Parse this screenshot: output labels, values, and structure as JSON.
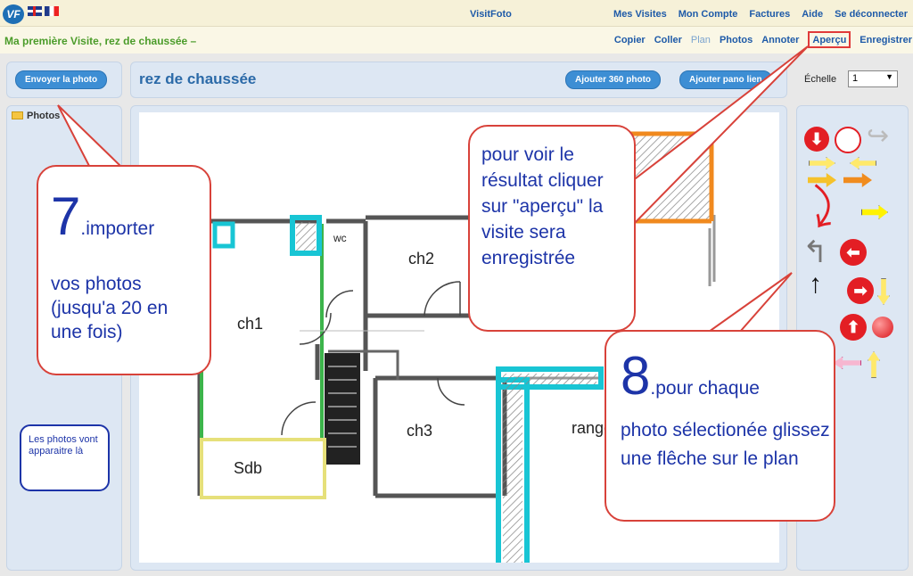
{
  "topbar": {
    "logo": "VF",
    "brand": "VisitFoto",
    "nav": [
      "Mes Visites",
      "Mon Compte",
      "Factures",
      "Aide",
      "Se déconnecter"
    ]
  },
  "subbar": {
    "title": "Ma première Visite, rez de chaussée –",
    "actions": {
      "copier": "Copier",
      "coller": "Coller",
      "plan": "Plan",
      "photos": "Photos",
      "annoter": "Annoter",
      "apercu": "Aperçu",
      "enregistrer": "Enregistrer"
    }
  },
  "left": {
    "send_button": "Envoyer la photo",
    "tree_label": "Photos",
    "note": "Les photos vont apparaitre là"
  },
  "header": {
    "title": "rez de chaussée",
    "add360": "Ajouter 360 photo",
    "add_pano": "Ajouter pano lien",
    "echelle_label": "Échelle",
    "echelle_value": "1"
  },
  "plan": {
    "rooms": [
      "ch1",
      "ch2",
      "ch3",
      "Sdb",
      "wc",
      "range"
    ]
  },
  "callouts": {
    "c7_num": "7",
    "c7_head": ".importer",
    "c7_body": "vos photos (jusqu'a 20 en une fois)",
    "c_apercu": "pour voir le résultat cliquer sur \"aperçu\" la visite sera enregistrée",
    "c8_num": "8",
    "c8_head": ".pour chaque",
    "c8_body": "photo sélectionée glissez une flêche sur le plan"
  },
  "colors": {
    "accent": "#1e5aa8",
    "callout_border": "#d8423a",
    "callout_text": "#1d34a8",
    "title_green": "#4b9c2a"
  }
}
